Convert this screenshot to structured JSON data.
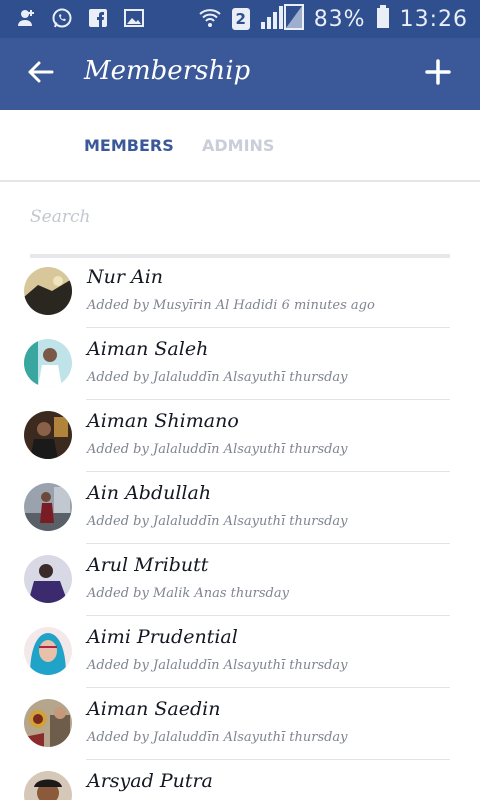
{
  "status_bar": {
    "battery_percent": "83%",
    "time": "13:26",
    "sim_slot": "2",
    "notification_icons": [
      "person-add-icon",
      "whatsapp-icon",
      "facebook-icon",
      "image-icon"
    ],
    "battery_level": 0.83
  },
  "app_bar": {
    "title": "Membership"
  },
  "tabs": [
    {
      "label": "MEMBERS",
      "active": true
    },
    {
      "label": "ADMINS",
      "active": false
    }
  ],
  "search": {
    "placeholder": "Search",
    "value": ""
  },
  "members": [
    {
      "name": "Nur Ain",
      "subtitle": "Added by Musyīrin Al Hadidi 6 minutes ago"
    },
    {
      "name": "Aiman Saleh",
      "subtitle": "Added by Jalaluddīn Alsayuthī thursday"
    },
    {
      "name": "Aiman Shimano",
      "subtitle": "Added by Jalaluddīn Alsayuthī thursday"
    },
    {
      "name": "Ain Abdullah",
      "subtitle": "Added by Jalaluddīn Alsayuthī thursday"
    },
    {
      "name": "Arul Mributt",
      "subtitle": "Added by Malik Anas thursday"
    },
    {
      "name": "Aimi Prudential",
      "subtitle": "Added by Jalaluddīn Alsayuthī thursday"
    },
    {
      "name": "Aiman Saedin",
      "subtitle": "Added by Jalaluddīn Alsayuthī thursday"
    },
    {
      "name": "Arsyad Putra",
      "subtitle": ""
    }
  ],
  "colors": {
    "status_bar": "#2f4f8f",
    "app_bar": "#3b5998",
    "active_tab": "#3b5998",
    "inactive_tab": "#c9ced8"
  }
}
